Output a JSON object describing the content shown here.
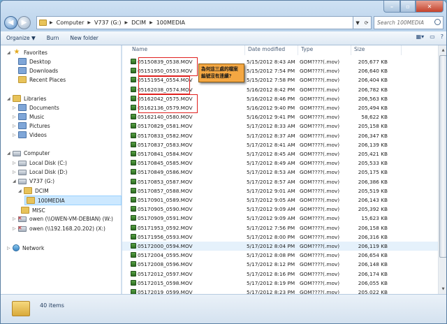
{
  "address": {
    "crumbs": [
      "Computer",
      "V737 (G:)",
      "DCIM",
      "100MEDIA"
    ]
  },
  "search": {
    "placeholder": "Search 100MEDIA"
  },
  "toolbar": {
    "organize": "Organize ▼",
    "burn": "Burn",
    "new_folder": "New folder"
  },
  "nav": {
    "favorites": "Favorites",
    "desktop": "Desktop",
    "downloads": "Downloads",
    "recent_places": "Recent Places",
    "libraries": "Libraries",
    "documents": "Documents",
    "music": "Music",
    "pictures": "Pictures",
    "videos": "Videos",
    "computer": "Computer",
    "local_c": "Local Disk (C:)",
    "local_d": "Local Disk (D:)",
    "v737": "V737 (G:)",
    "dcim": "DCIM",
    "media": "100MEDIA",
    "misc": "MISC",
    "owen_w": "owen (\\\\OWEN-VM-DEBIAN) (W:)",
    "owen_x": "owen (\\\\192.168.20.202) (X:)",
    "network": "Network"
  },
  "columns": {
    "name": "Name",
    "date": "Date modified",
    "type": "Type",
    "size": "Size"
  },
  "files": [
    {
      "name": "05150839_0538.MOV",
      "date": "5/15/2012 8:43 AM",
      "type": "GOM????(.mov)",
      "size": "205,677 KB"
    },
    {
      "name": "05151950_0553.MOV",
      "date": "5/15/2012 7:54 PM",
      "type": "GOM????(.mov)",
      "size": "206,640 KB"
    },
    {
      "name": "05151954_0554.MOV",
      "date": "5/15/2012 7:58 PM",
      "type": "GOM????(.mov)",
      "size": "206,404 KB"
    },
    {
      "name": "05162038_0574.MOV",
      "date": "5/16/2012 8:42 PM",
      "type": "GOM????(.mov)",
      "size": "206,782 KB"
    },
    {
      "name": "05162042_0575.MOV",
      "date": "5/16/2012 8:46 PM",
      "type": "GOM????(.mov)",
      "size": "206,563 KB"
    },
    {
      "name": "05162136_0579.MOV",
      "date": "5/16/2012 9:40 PM",
      "type": "GOM????(.mov)",
      "size": "205,494 KB"
    },
    {
      "name": "05162140_0580.MOV",
      "date": "5/16/2012 9:41 PM",
      "type": "GOM????(.mov)",
      "size": "58,622 KB"
    },
    {
      "name": "05170829_0581.MOV",
      "date": "5/17/2012 8:33 AM",
      "type": "GOM????(.mov)",
      "size": "205,158 KB"
    },
    {
      "name": "05170833_0582.MOV",
      "date": "5/17/2012 8:37 AM",
      "type": "GOM????(.mov)",
      "size": "206,347 KB"
    },
    {
      "name": "05170837_0583.MOV",
      "date": "5/17/2012 8:41 AM",
      "type": "GOM????(.mov)",
      "size": "206,139 KB"
    },
    {
      "name": "05170841_0584.MOV",
      "date": "5/17/2012 8:45 AM",
      "type": "GOM????(.mov)",
      "size": "205,421 KB"
    },
    {
      "name": "05170845_0585.MOV",
      "date": "5/17/2012 8:49 AM",
      "type": "GOM????(.mov)",
      "size": "205,533 KB"
    },
    {
      "name": "05170849_0586.MOV",
      "date": "5/17/2012 8:53 AM",
      "type": "GOM????(.mov)",
      "size": "205,175 KB"
    },
    {
      "name": "05170853_0587.MOV",
      "date": "5/17/2012 8:57 AM",
      "type": "GOM????(.mov)",
      "size": "206,386 KB"
    },
    {
      "name": "05170857_0588.MOV",
      "date": "5/17/2012 9:01 AM",
      "type": "GOM????(.mov)",
      "size": "205,519 KB"
    },
    {
      "name": "05170901_0589.MOV",
      "date": "5/17/2012 9:05 AM",
      "type": "GOM????(.mov)",
      "size": "206,143 KB"
    },
    {
      "name": "05170905_0590.MOV",
      "date": "5/17/2012 9:09 AM",
      "type": "GOM????(.mov)",
      "size": "205,392 KB"
    },
    {
      "name": "05170909_0591.MOV",
      "date": "5/17/2012 9:09 AM",
      "type": "GOM????(.mov)",
      "size": "15,623 KB"
    },
    {
      "name": "05171953_0592.MOV",
      "date": "5/17/2012 7:56 PM",
      "type": "GOM????(.mov)",
      "size": "206,158 KB"
    },
    {
      "name": "05171956_0593.MOV",
      "date": "5/17/2012 8:00 PM",
      "type": "GOM????(.mov)",
      "size": "206,316 KB"
    },
    {
      "name": "05172000_0594.MOV",
      "date": "5/17/2012 8:04 PM",
      "type": "GOM????(.mov)",
      "size": "206,119 KB"
    },
    {
      "name": "05172004_0595.MOV",
      "date": "5/17/2012 8:08 PM",
      "type": "GOM????(.mov)",
      "size": "206,654 KB"
    },
    {
      "name": "05172008_0596.MOV",
      "date": "5/17/2012 8:12 PM",
      "type": "GOM????(.mov)",
      "size": "206,148 KB"
    },
    {
      "name": "05172012_0597.MOV",
      "date": "5/17/2012 8:16 PM",
      "type": "GOM????(.mov)",
      "size": "206,174 KB"
    },
    {
      "name": "05172015_0598.MOV",
      "date": "5/17/2012 8:19 PM",
      "type": "GOM????(.mov)",
      "size": "206,055 KB"
    },
    {
      "name": "05172019_0599.MOV",
      "date": "5/17/2012 8:23 PM",
      "type": "GOM????(.mov)",
      "size": "205,022 KB"
    }
  ],
  "annotation": {
    "text": "為何這三處的檔案編號沒有連續?"
  },
  "status": {
    "count": "40 items"
  }
}
